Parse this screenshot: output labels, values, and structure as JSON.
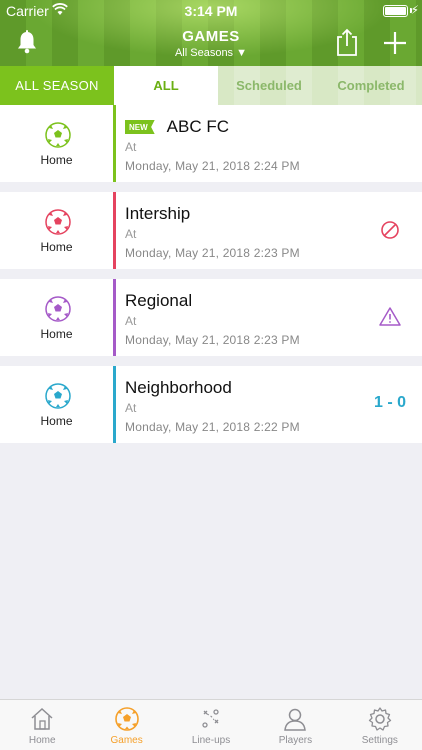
{
  "status_bar": {
    "carrier": "Carrier",
    "time": "3:14 PM"
  },
  "header": {
    "title": "GAMES",
    "season_filter": "All Seasons ▼"
  },
  "tabs": {
    "all_season": "ALL SEASON",
    "all": "ALL",
    "scheduled": "Scheduled",
    "completed": "Completed"
  },
  "games": [
    {
      "venue": "Home",
      "name": "ABC FC",
      "badge": "NEW",
      "at": "At",
      "datetime": "Monday, May 21, 2018 2:24 PM",
      "color": "#7cc21d",
      "status": ""
    },
    {
      "venue": "Home",
      "name": "Intership",
      "at": "At",
      "datetime": "Monday, May 21, 2018 2:23 PM",
      "color": "#e5435f",
      "status": "cancelled-icon"
    },
    {
      "venue": "Home",
      "name": "Regional",
      "at": "At",
      "datetime": "Monday, May 21, 2018 2:23 PM",
      "color": "#a55ac8",
      "status": "warning-icon"
    },
    {
      "venue": "Home",
      "name": "Neighborhood",
      "at": "At",
      "datetime": "Monday, May 21, 2018 2:22 PM",
      "color": "#2aa8cc",
      "score": "1 - 0"
    }
  ],
  "bottom_nav": {
    "home": "Home",
    "games": "Games",
    "lineups": "Line-ups",
    "players": "Players",
    "settings": "Settings"
  },
  "colors": {
    "accent_green": "#7cc21d",
    "active_orange": "#f5a02a"
  }
}
